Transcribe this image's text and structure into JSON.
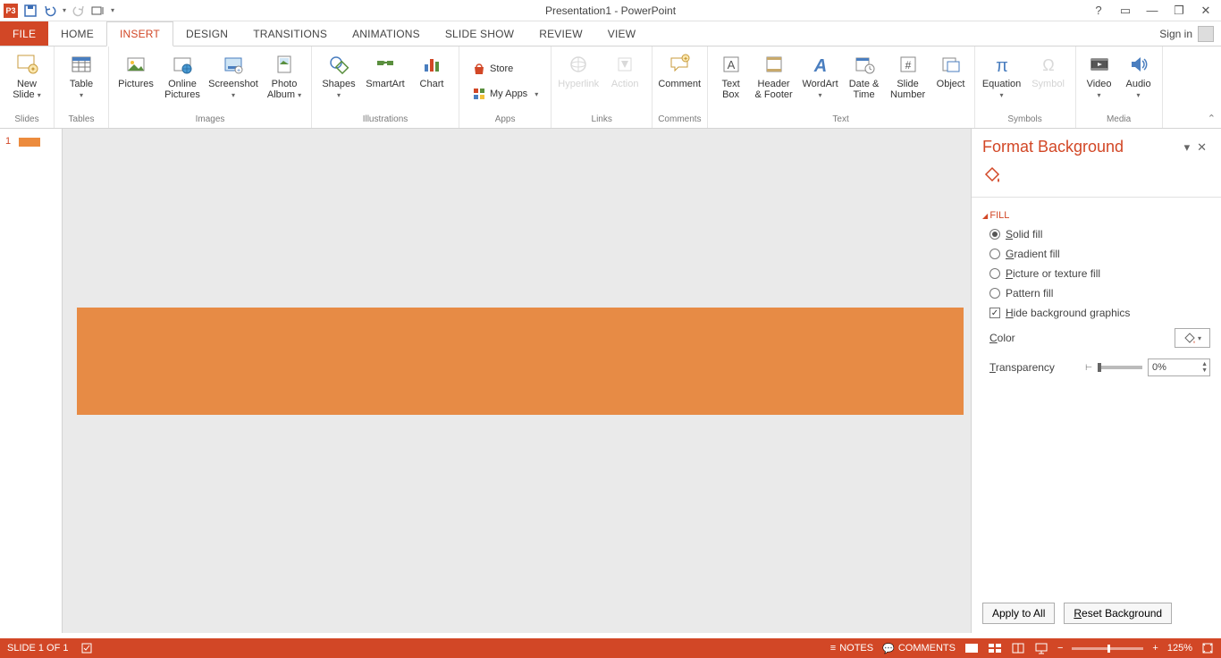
{
  "title": "Presentation1 - PowerPoint",
  "qat": {
    "app": "P3"
  },
  "win": {
    "help": "?",
    "ribbon_opts": "▭",
    "min": "—",
    "restore": "❐",
    "close": "✕"
  },
  "tabs": {
    "file": "FILE",
    "home": "HOME",
    "insert": "INSERT",
    "design": "DESIGN",
    "transitions": "TRANSITIONS",
    "animations": "ANIMATIONS",
    "slideshow": "SLIDE SHOW",
    "review": "REVIEW",
    "view": "VIEW"
  },
  "signin": "Sign in",
  "ribbon": {
    "slides": {
      "new_slide": "New\nSlide",
      "group": "Slides"
    },
    "tables": {
      "table": "Table",
      "group": "Tables"
    },
    "images": {
      "pictures": "Pictures",
      "online_pictures": "Online\nPictures",
      "screenshot": "Screenshot",
      "photo_album": "Photo\nAlbum",
      "group": "Images"
    },
    "illustrations": {
      "shapes": "Shapes",
      "smartart": "SmartArt",
      "chart": "Chart",
      "group": "Illustrations"
    },
    "apps": {
      "store": "Store",
      "my_apps": "My Apps",
      "group": "Apps"
    },
    "links": {
      "hyperlink": "Hyperlink",
      "action": "Action",
      "group": "Links"
    },
    "comments": {
      "comment": "Comment",
      "group": "Comments"
    },
    "text": {
      "text_box": "Text\nBox",
      "header_footer": "Header\n& Footer",
      "wordart": "WordArt",
      "date_time": "Date &\nTime",
      "slide_number": "Slide\nNumber",
      "object": "Object",
      "group": "Text"
    },
    "symbols": {
      "equation": "Equation",
      "symbol": "Symbol",
      "group": "Symbols"
    },
    "media": {
      "video": "Video",
      "audio": "Audio",
      "group": "Media"
    }
  },
  "thumbnails": {
    "slide1_num": "1"
  },
  "format_pane": {
    "title": "Format Background",
    "section_fill": "Fill",
    "solid_fill": "Solid fill",
    "gradient_fill": "Gradient fill",
    "picture_texture": "Picture or texture fill",
    "pattern_fill": "Pattern fill",
    "hide_bg": "Hide background graphics",
    "color_label": "Color",
    "transparency_label": "Transparency",
    "transparency_value": "0%",
    "apply_all": "Apply to All",
    "reset": "Reset Background"
  },
  "status": {
    "slide_of": "SLIDE 1 OF 1",
    "notes": "NOTES",
    "comments": "COMMENTS",
    "zoom": "125%"
  }
}
